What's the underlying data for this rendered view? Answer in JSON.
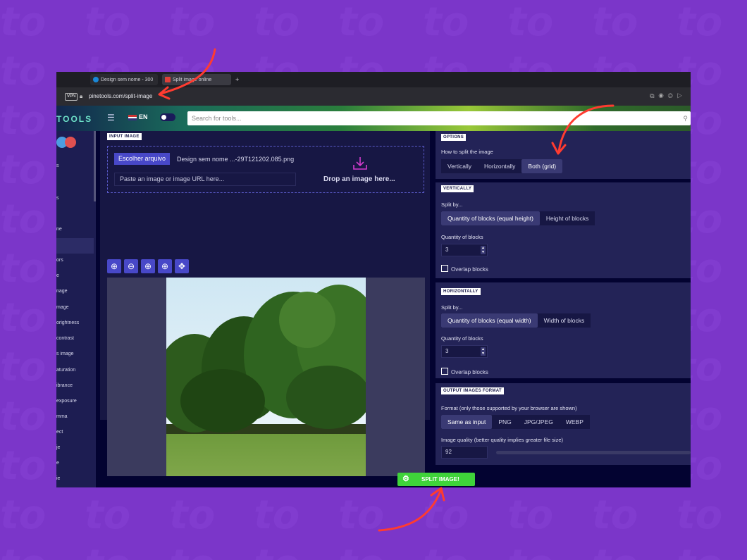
{
  "browser": {
    "tabs": [
      {
        "label": "Design sem nome - 300"
      },
      {
        "label": "Split image online"
      }
    ],
    "new_tab": "+",
    "vpn": "VPN",
    "url": "pinetools.com/split-image"
  },
  "site": {
    "logo": "TOOLS",
    "lang": "EN",
    "search_placeholder": "Search for tools..."
  },
  "sidebar": {
    "items": [
      "s",
      "s",
      "ne",
      "ors",
      "e",
      "nage",
      "mage",
      "orightness",
      "contrast",
      "s image",
      "aturation",
      "ibrance",
      "exposure",
      "mma",
      "ect",
      "je",
      "e",
      "ie"
    ]
  },
  "input_image": {
    "pill": "INPUT IMAGE",
    "choose_button": "Escolher arquivo",
    "file_name": "Design sem nome ...-29T121202.085.png",
    "paste_placeholder": "Paste an image or image URL here...",
    "drop_text": "Drop an image here..."
  },
  "options": {
    "pill": "OPTIONS",
    "how_label": "How to split the image",
    "modes": [
      "Vertically",
      "Horizontally",
      "Both (grid)"
    ],
    "selected_mode": "Both (grid)"
  },
  "vertically": {
    "pill": "VERTICALLY",
    "split_by_label": "Split by...",
    "options": [
      "Quantity of blocks (equal height)",
      "Height of blocks"
    ],
    "qty_label": "Quantity of blocks",
    "qty_value": "3",
    "overlap_label": "Overlap blocks"
  },
  "horizontally": {
    "pill": "HORIZONTALLY",
    "split_by_label": "Split by...",
    "options": [
      "Quantity of blocks (equal width)",
      "Width of blocks"
    ],
    "qty_label": "Quantity of blocks",
    "qty_value": "3",
    "overlap_label": "Overlap blocks"
  },
  "output": {
    "pill": "OUTPUT IMAGES FORMAT",
    "format_label": "Format (only those supported by your browser are shown)",
    "formats": [
      "Same as input",
      "PNG",
      "JPG/JPEG",
      "WEBP"
    ],
    "quality_label": "Image quality (better quality implies greater file size)",
    "quality_value": "92"
  },
  "action": {
    "split_button": "SPLIT IMAGE!"
  },
  "colors": {
    "background": "#7b36c9",
    "accent": "#4848c8",
    "action": "#3fd33a",
    "arrow": "#ff3b30"
  }
}
